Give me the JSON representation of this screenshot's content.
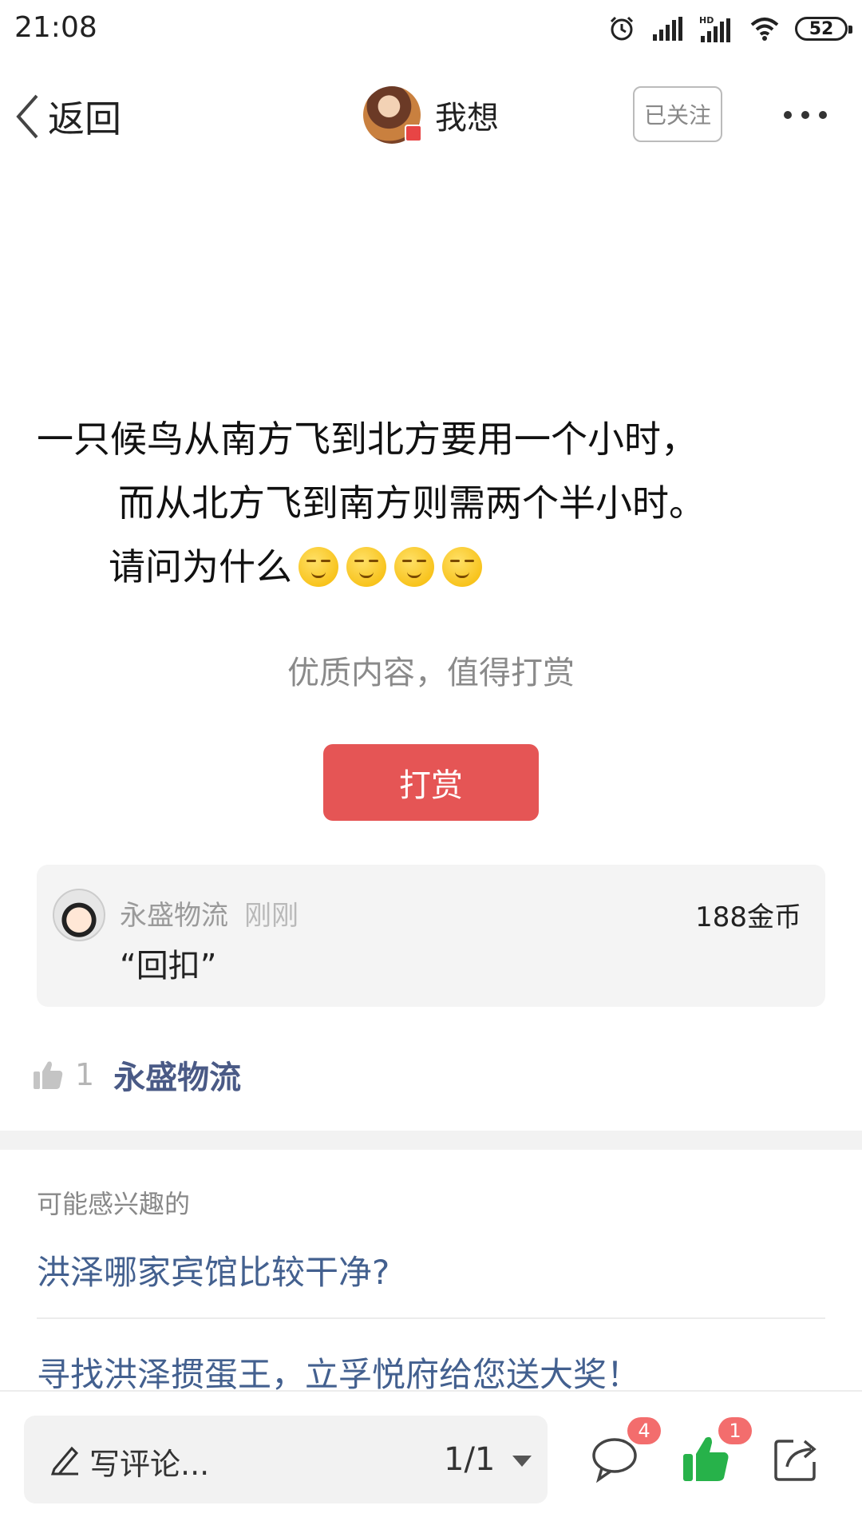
{
  "status_bar": {
    "time": "21:08",
    "battery": "52",
    "icons": [
      "alarm-icon",
      "signal-icon",
      "hd-signal-icon",
      "wifi-icon",
      "battery-icon"
    ]
  },
  "header": {
    "back_label": "返回",
    "author_name": "我想",
    "follow_label": "已关注",
    "more_icon": "more-icon"
  },
  "post": {
    "line1": "一只候鸟从南方飞到北方要用一个小时，",
    "line2": "而从北方飞到南方则需两个半小时。",
    "line3": "请问为什么",
    "emoji_count": 4
  },
  "reward": {
    "hint": "优质内容，值得打赏",
    "button_label": "打赏",
    "record": {
      "name": "永盛物流",
      "time": "刚刚",
      "coins": "188金币",
      "text": "“回扣”"
    }
  },
  "likes": {
    "count": "1",
    "user": "永盛物流"
  },
  "related": {
    "title": "可能感兴趣的",
    "items": [
      "洪泽哪家宾馆比较干净?",
      "寻找洪泽掼蛋王，立孚悦府给您送大奖！"
    ]
  },
  "bottom_bar": {
    "comment_placeholder": "写评论...",
    "page_indicator": "1/1",
    "comment_badge": "4",
    "like_badge": "1"
  },
  "colors": {
    "accent_red": "#e55555",
    "link_blue": "#43608f",
    "like_green": "#27b24a"
  }
}
